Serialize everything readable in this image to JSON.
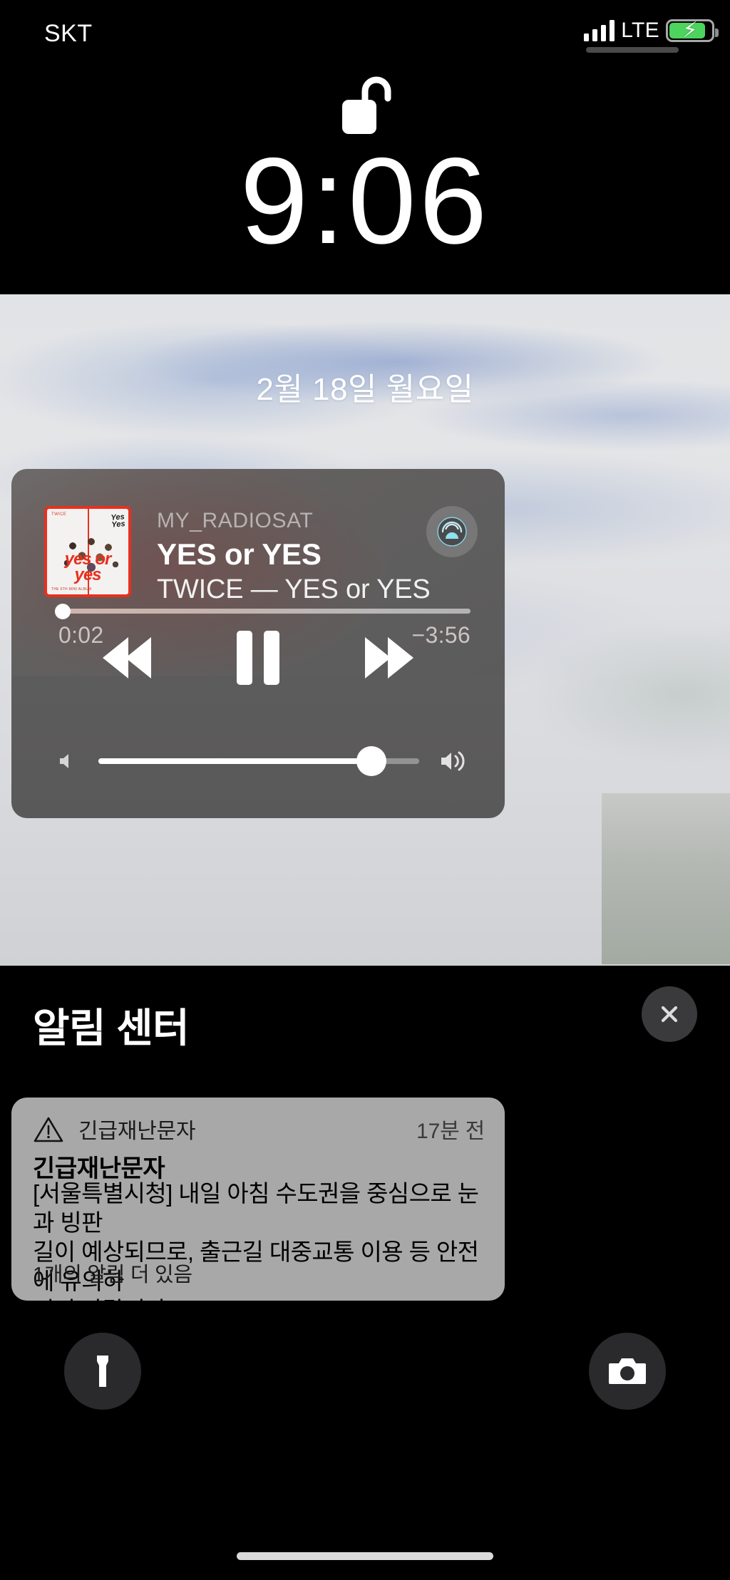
{
  "status_bar": {
    "carrier": "SKT",
    "network": "LTE",
    "signal_bars": 4,
    "battery_percent": 86,
    "battery_charging": true
  },
  "lock": {
    "state": "unlocked",
    "icon": "unlocked-padlock-icon"
  },
  "clock": {
    "time": "9:06",
    "date": "2월 18일 월요일"
  },
  "now_playing": {
    "app_name": "MY_RADIOSAT",
    "title": "YES or YES",
    "subtitle": "TWICE — YES or YES",
    "album_art": {
      "top_label": "TWICE",
      "logo_line1": "Yes",
      "logo_line2": "or",
      "logo_line3": "Yes",
      "big_text": "yes or yes",
      "bottom_label": "THE 6TH MINI ALBUM"
    },
    "airplay_icon": "airplay-audio-icon",
    "elapsed": "0:02",
    "remaining": "−3:56",
    "progress_percent": 1,
    "volume_percent": 85,
    "controls": {
      "previous": "rewind-icon",
      "play_pause": "pause-icon",
      "next": "fast-forward-icon",
      "volume_low": "volume-low-icon",
      "volume_high": "volume-high-icon"
    }
  },
  "notification_center": {
    "title": "알림 센터",
    "close_icon": "close-icon",
    "notification": {
      "icon": "warning-triangle-icon",
      "app_name": "긴급재난문자",
      "time": "17분 전",
      "title": "긴급재난문자",
      "body": "[서울특별시청] 내일 아침 수도권을 중심으로 눈과 빙판\n길이 예상되므로, 출근길 대중교통 이용 등 안전에 유의하\n시기 바랍니다.",
      "more": "1개의 알림 더 있음"
    }
  },
  "bottom_buttons": {
    "flashlight": "flashlight-icon",
    "camera": "camera-icon"
  },
  "home_indicator": "home-indicator",
  "colors": {
    "battery_green": "#4cd45e",
    "album_red": "#e8301f",
    "card_gray": "#5d5c5c",
    "notification_gray": "#a8a8a8"
  }
}
